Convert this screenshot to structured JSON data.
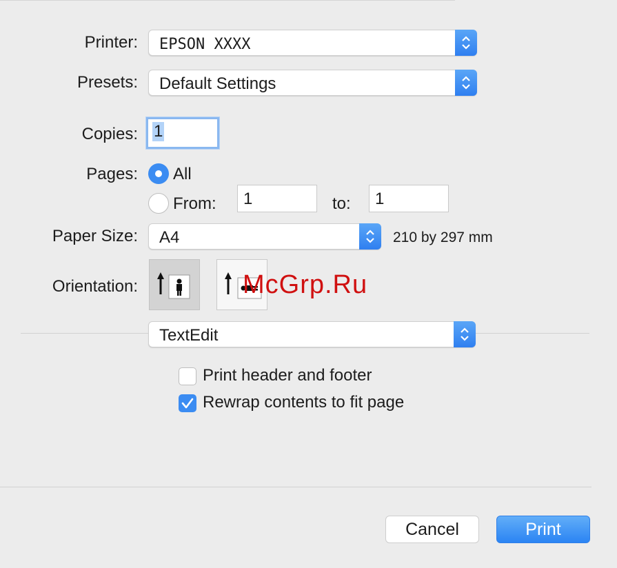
{
  "printer": {
    "label": "Printer:",
    "value": "EPSON XXXX"
  },
  "presets": {
    "label": "Presets:",
    "value": "Default Settings"
  },
  "copies": {
    "label": "Copies:",
    "value": "1"
  },
  "pages": {
    "label": "Pages:",
    "all_label": "All",
    "from_label": "From:",
    "from_value": "1",
    "to_label": "to:",
    "to_value": "1",
    "selected": "All"
  },
  "paper_size": {
    "label": "Paper Size:",
    "value": "A4",
    "dimensions": "210 by 297 mm"
  },
  "orientation": {
    "label": "Orientation:",
    "selected": "portrait"
  },
  "app_menu": {
    "value": "TextEdit"
  },
  "options": {
    "print_header_footer": {
      "label": "Print header and footer",
      "checked": false
    },
    "rewrap_contents": {
      "label": "Rewrap contents to fit page",
      "checked": true
    }
  },
  "buttons": {
    "cancel": "Cancel",
    "print": "Print"
  },
  "watermark": "McGrp.Ru",
  "colors": {
    "accent": "#3b8cf2",
    "watermark": "#d01010",
    "background": "#ececec"
  }
}
